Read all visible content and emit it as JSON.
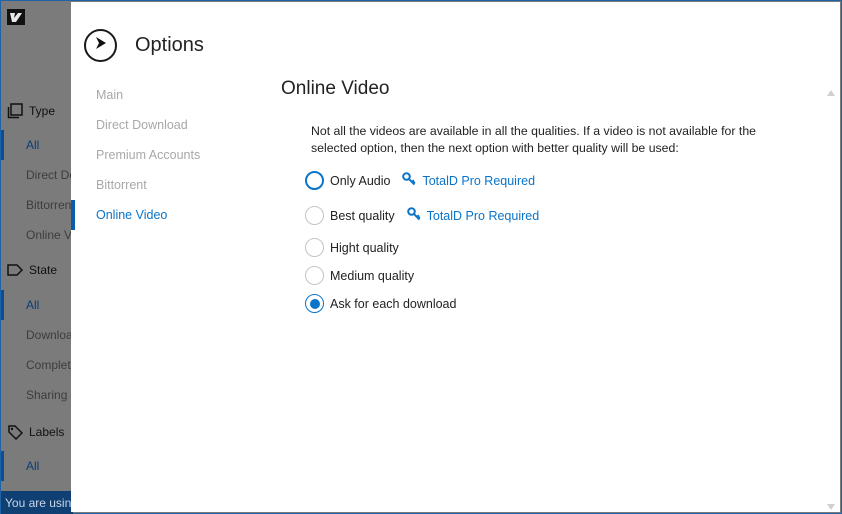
{
  "background": {
    "sections": [
      {
        "label": "Type",
        "icon": "copy-icon"
      },
      {
        "label": "State",
        "icon": "tag-icon"
      },
      {
        "label": "Labels",
        "icon": "labels-icon"
      }
    ],
    "type_items": [
      "All",
      "Direct Do",
      "Bittorren",
      "Online V"
    ],
    "state_items": [
      "All",
      "Downloa",
      "Complet",
      "Sharing"
    ],
    "labels_items": [
      "All"
    ],
    "status_text": "You are using"
  },
  "dialog": {
    "title": "Options",
    "back_icon": "chevron-right-circle-icon",
    "nav": [
      "Main",
      "Direct Download",
      "Premium Accounts",
      "Bittorrent",
      "Online Video"
    ],
    "active_nav": "Online Video",
    "section_title": "Online Video",
    "description": "Not all the videos are available in all the qualities. If a video is not available for the selected option, then the next option with better quality will be used:",
    "options": [
      {
        "label": "Only Audio",
        "pro": "TotalD Pro Required",
        "state": "focused"
      },
      {
        "label": "Best quality",
        "pro": "TotalD Pro Required",
        "state": "unchecked"
      },
      {
        "label": "Hight quality",
        "state": "unchecked"
      },
      {
        "label": "Medium quality",
        "state": "unchecked"
      },
      {
        "label": "Ask for each download",
        "state": "checked"
      }
    ],
    "pro_icon": "key-icon"
  },
  "colors": {
    "accent": "#0a74c9",
    "background_overlay": "#7b7b7b",
    "status_bar": "#0f3f73"
  }
}
